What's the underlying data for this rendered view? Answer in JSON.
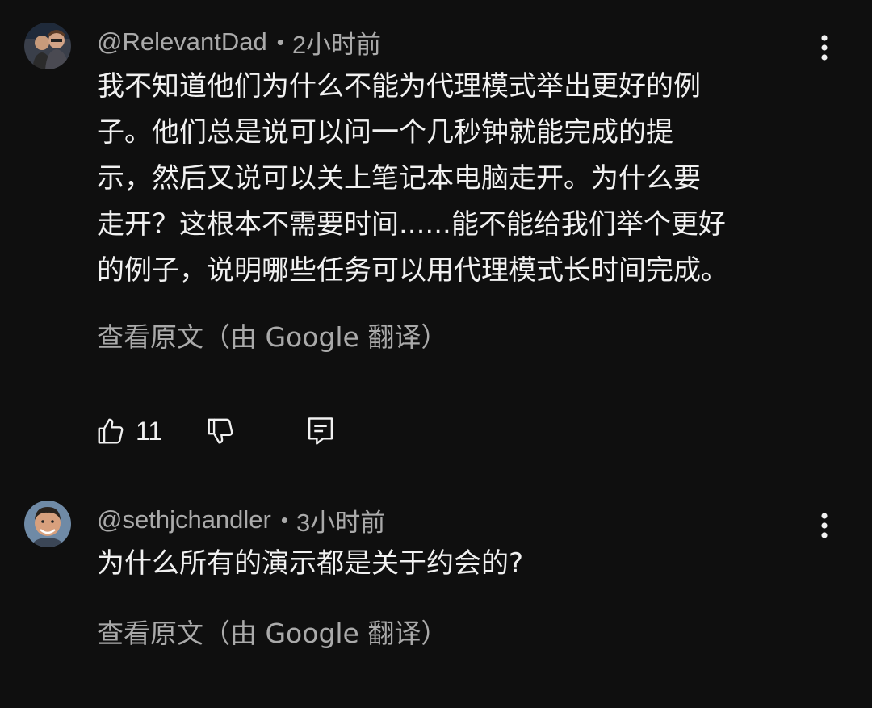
{
  "colors": {
    "background": "#0f0f0f",
    "text": "#f1f1f1",
    "muted": "#aaaaaa"
  },
  "comments": [
    {
      "author": "@RelevantDad",
      "separator": "•",
      "time": "2小时前",
      "body_lines": [
        "我不知道他们为什么不能为代理模式举出更好的例",
        "子。他们总是说可以问一个几秒钟就能完成的提",
        "示，然后又说可以关上笔记本电脑走开。为什么要",
        "走开？这根本不需要时间......能不能给我们举个更好",
        "的例子，说明哪些任务可以用代理模式长时间完成。"
      ],
      "translate_label": "查看原文（由 Google 翻译）",
      "like_count": "11",
      "icons": [
        "thumbs-up-icon",
        "thumbs-down-icon",
        "reply-icon",
        "more-vertical-icon"
      ]
    },
    {
      "author": "@sethjchandler",
      "separator": "•",
      "time": "3小时前",
      "body_lines": [
        "为什么所有的演示都是关于约会的?"
      ],
      "translate_label": "查看原文（由 Google 翻译）",
      "icons": [
        "more-vertical-icon"
      ]
    }
  ]
}
